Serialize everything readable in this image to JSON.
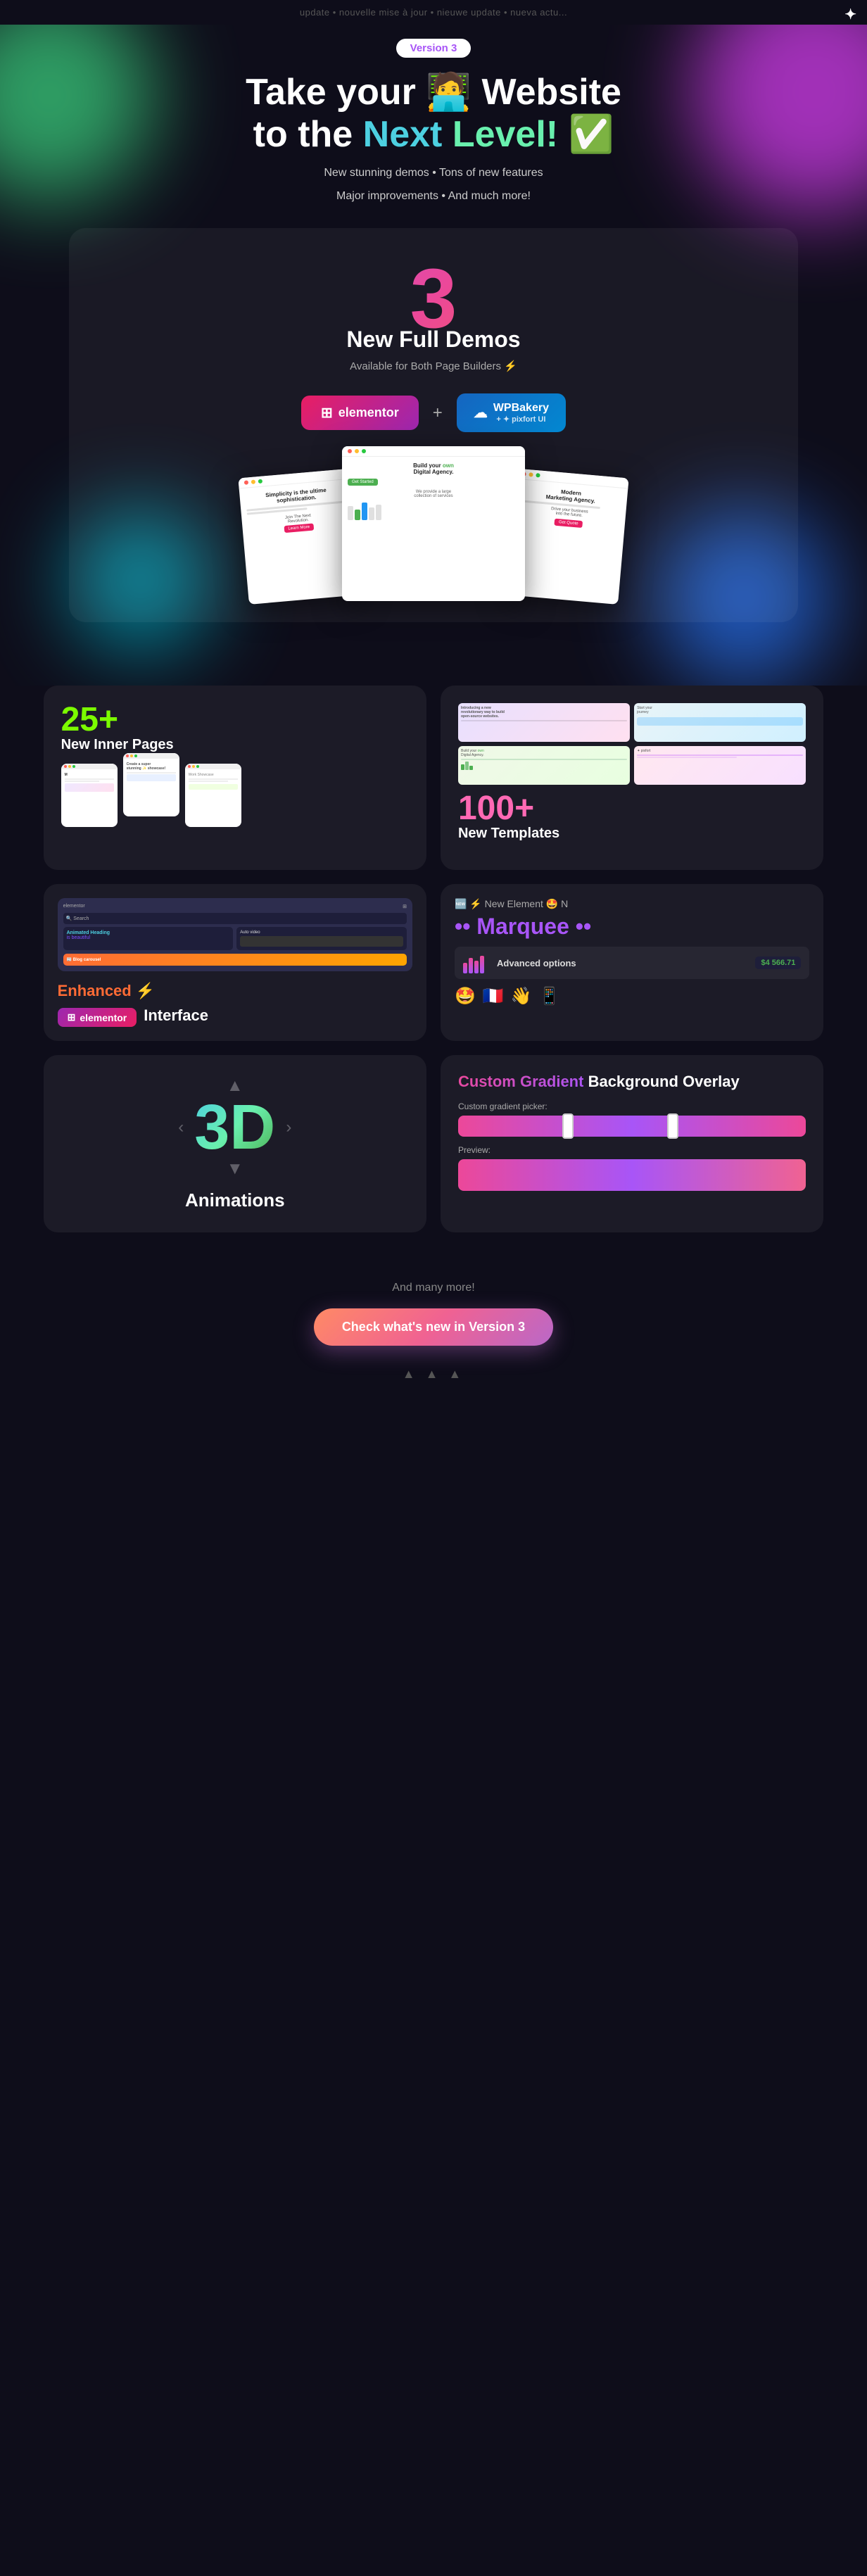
{
  "ticker": {
    "text": "update  •  nouvelle mise à jour  •  nieuwe update  •  nueva actu..."
  },
  "logo": {
    "symbol": "✦"
  },
  "hero": {
    "version_badge": "Version 3",
    "title_line1": "Take your 🧑‍💻 Website",
    "title_line2_normal": "to the ",
    "title_line2_accent1": "Next",
    "title_line2_space": " ",
    "title_line2_accent2": "Level!",
    "title_line2_emoji": " ✅",
    "subtitle1": "New stunning demos  •  Tons of new features",
    "subtitle2": "Major improvements  •  And much more!"
  },
  "demos": {
    "number": "3",
    "title": "New Full Demos",
    "subtitle": "Available for Both Page Builders ⚡",
    "elementor_label": "elementor",
    "wpbakery_label": "WPBakery",
    "pixfort_label": "+ ✦ pixfort UI",
    "plus": "+"
  },
  "inner_pages": {
    "number": "25+",
    "label": "New Inner Pages"
  },
  "templates": {
    "number": "100+",
    "label": "New Templates"
  },
  "elementor_section": {
    "enhanced_label": "Enhanced ⚡",
    "elementor_badge": "elementor",
    "interface_label": "Interface",
    "topbar_left": "elementor",
    "widget1": "Animated Heading",
    "widget2": "Auto video",
    "widget3_label": "Blog carousel",
    "app_name": "elementor"
  },
  "marquee_section": {
    "new_element_text": "🆕 ⚡ New Element 🤩 N",
    "marquee_title": "•• Marquee ••",
    "advanced_label": "Advanced options",
    "price": "$4 566.71",
    "emojis": [
      "🤩",
      "🇫🇷",
      "👋",
      "📱"
    ]
  },
  "threed": {
    "text": "3D",
    "label": "Animations"
  },
  "gradient": {
    "title_accent": "Custom Gradient",
    "title_normal": " Background Overlay",
    "picker_label": "Custom gradient picker:",
    "preview_label": "Preview:"
  },
  "cta": {
    "and_more": "And many more!",
    "button_label": "Check what's new in Version 3"
  },
  "bottom_arrows": "▲  ▲  ▲"
}
